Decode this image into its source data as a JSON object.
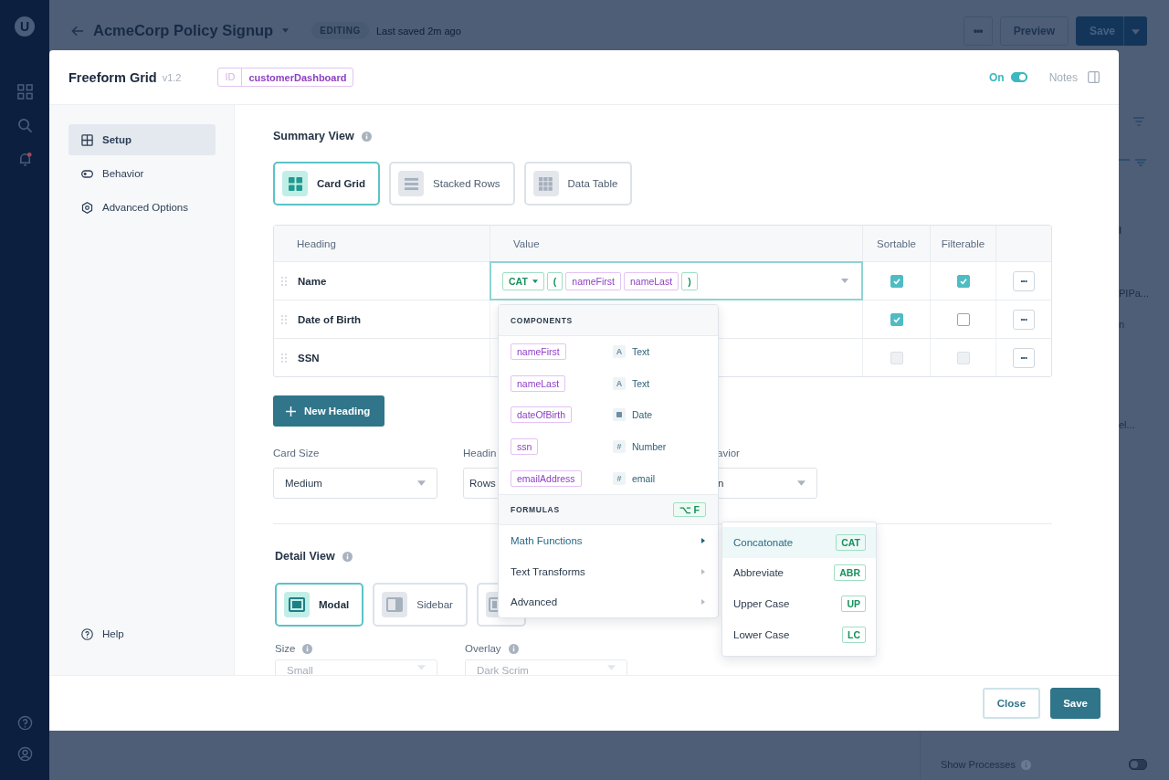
{
  "rail": {
    "logo": "U",
    "alerts": true
  },
  "app": {
    "title": "AcmeCorp Policy Signup",
    "status": "EDITING",
    "saved": "Last saved 2m ago",
    "more": "•••",
    "preview": "Preview",
    "save": "Save"
  },
  "background": {
    "texts": [
      "l",
      "PIPa...",
      "n",
      "el..."
    ],
    "show_processes": {
      "label": "Show Processes",
      "on": false
    }
  },
  "modal": {
    "title": "Freeform Grid",
    "version": "v1.2",
    "id_label": "ID",
    "id_value": "customerDashboard",
    "toggle": {
      "label": "On",
      "on": true
    },
    "notes": "Notes"
  },
  "sidebar": {
    "items": [
      {
        "label": "Setup",
        "kind": "grid",
        "selected": true
      },
      {
        "label": "Behavior",
        "kind": "toggle",
        "selected": false
      },
      {
        "label": "Advanced Options",
        "kind": "gear",
        "selected": false
      }
    ],
    "help": "Help"
  },
  "summary": {
    "title": "Summary View",
    "views": [
      {
        "label": "Card Grid",
        "kind": "cards",
        "selected": true
      },
      {
        "label": "Stacked Rows",
        "kind": "rows",
        "selected": false
      },
      {
        "label": "Data Table",
        "kind": "table",
        "selected": false
      }
    ]
  },
  "table": {
    "columns": [
      "Heading",
      "Value",
      "Sortable",
      "Filterable"
    ],
    "rows": [
      {
        "heading": "Name",
        "editing": true,
        "tokens": [
          {
            "text": "CAT",
            "kind": "function"
          },
          {
            "text": "(",
            "kind": "paren"
          },
          {
            "text": "nameFirst",
            "kind": "field"
          },
          {
            "text": "nameLast",
            "kind": "field"
          },
          {
            "text": ")",
            "kind": "paren"
          }
        ],
        "sortable": {
          "checked": true,
          "disabled": false
        },
        "filterable": {
          "checked": true,
          "disabled": false
        },
        "more": "•••"
      },
      {
        "heading": "Date of Birth",
        "editing": false,
        "sortable": {
          "checked": true,
          "disabled": false
        },
        "filterable": {
          "checked": false,
          "disabled": false
        },
        "more": "•••"
      },
      {
        "heading": "SSN",
        "editing": false,
        "sortable": {
          "checked": false,
          "disabled": true
        },
        "filterable": {
          "checked": false,
          "disabled": true
        },
        "more": "•••"
      }
    ]
  },
  "new_heading": "New Heading",
  "fields": [
    {
      "label": "Card Size",
      "value": "Medium"
    },
    {
      "label": "Headin",
      "value": "Rows"
    },
    {
      "label": "avior",
      "value": "n"
    }
  ],
  "detail": {
    "title": "Detail View",
    "views": [
      {
        "label": "Modal",
        "kind": "modal",
        "selected": true
      },
      {
        "label": "Sidebar",
        "kind": "sidebar",
        "selected": false
      },
      {
        "kind": "inset",
        "selected": false
      }
    ]
  },
  "detail_fields": [
    {
      "label": "Size",
      "value": "Small"
    },
    {
      "label": "Overlay",
      "value": "Dark Scrim"
    }
  ],
  "footer": {
    "close": "Close",
    "save": "Save"
  },
  "menu": {
    "components_title": "COMPONENTS",
    "components": [
      {
        "name": "nameFirst",
        "kind": "text",
        "glyph": "A",
        "type": "Text"
      },
      {
        "name": "nameLast",
        "kind": "text",
        "glyph": "A",
        "type": "Text"
      },
      {
        "name": "dateOfBirth",
        "kind": "date",
        "type": "Date"
      },
      {
        "name": "ssn",
        "kind": "number",
        "glyph": "#",
        "type": "Number"
      },
      {
        "name": "emailAddress",
        "kind": "number",
        "glyph": "#",
        "type": "email"
      }
    ],
    "formulas_title": "FORMULAS",
    "shortcut": "⌥ F",
    "formulas": [
      {
        "label": "Math Functions",
        "selected": true
      },
      {
        "label": "Text Transforms",
        "selected": false
      },
      {
        "label": "Advanced",
        "selected": false
      }
    ]
  },
  "submenu": [
    {
      "label": "Concatonate",
      "code": "CAT",
      "selected": true
    },
    {
      "label": "Abbreviate",
      "code": "ABR",
      "selected": false
    },
    {
      "label": "Upper Case",
      "code": "UP",
      "selected": false
    },
    {
      "label": "Lower Case",
      "code": "LC",
      "selected": false
    }
  ]
}
